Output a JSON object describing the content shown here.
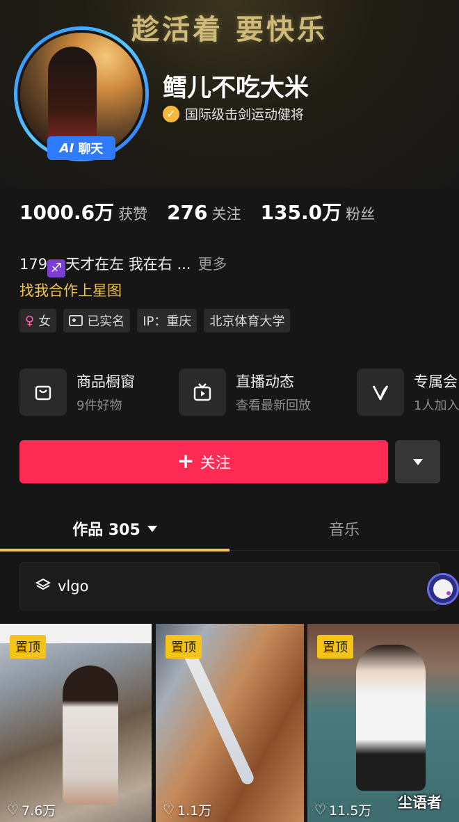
{
  "banner": {
    "slogan": "趁活着 要快乐"
  },
  "profile": {
    "ai_badge_ai": "AI",
    "ai_badge_label": "聊天",
    "name": "鳕儿不吃大米",
    "verification": "国际级击剑运动健将"
  },
  "stats": [
    {
      "value": "1000.6万",
      "label": "获赞"
    },
    {
      "value": "276",
      "label": "关注"
    },
    {
      "value": "135.0万",
      "label": "粉丝"
    }
  ],
  "bio": {
    "prefix": "179",
    "zodiac_icon": "sagittarius-icon",
    "text": "天才在左 我在右 ...",
    "more": "更多",
    "cooperate": "找我合作上星图"
  },
  "tags": [
    {
      "icon": "female-icon",
      "label": "女"
    },
    {
      "icon": "id-card-icon",
      "label": "已实名"
    },
    {
      "label": "IP：重庆"
    },
    {
      "label": "北京体育大学"
    }
  ],
  "features": [
    {
      "icon": "shopping-bag-icon",
      "title": "商品橱窗",
      "subtitle": "9件好物"
    },
    {
      "icon": "tv-play-icon",
      "title": "直播动态",
      "subtitle": "查看最新回放"
    },
    {
      "icon": "v-logo-icon",
      "title": "专属会",
      "subtitle": "1人加入"
    }
  ],
  "actions": {
    "follow": "关注"
  },
  "tabs": {
    "works": "作品 305",
    "music": "音乐"
  },
  "collection": {
    "label": "vlgo"
  },
  "videos": [
    {
      "pin": "置顶",
      "likes": "7.6万"
    },
    {
      "pin": "置顶",
      "likes": "1.1万"
    },
    {
      "pin": "置顶",
      "likes": "11.5万"
    }
  ],
  "watermark": "尘语者",
  "colors": {
    "follow": "#fe2c55",
    "accent": "#f4c24a",
    "pin": "#f4c418",
    "ai_badge": "#2f7bff"
  }
}
